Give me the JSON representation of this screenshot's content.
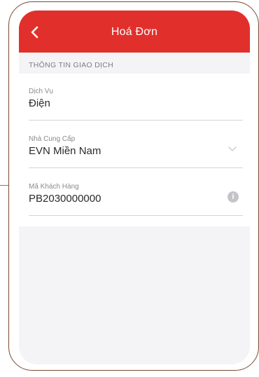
{
  "header": {
    "title": "Hoá Đơn",
    "back_icon": "chevron-left-icon",
    "bg_color": "#e1302c"
  },
  "section": {
    "label": "THÔNG TIN GIAO DỊCH"
  },
  "fields": [
    {
      "label": "Dịch Vụ",
      "value": "Điện"
    },
    {
      "label": "Nhà Cung Cấp",
      "value": "EVN Miền Nam",
      "icon": "chevron-down-icon"
    },
    {
      "label": "Mã Khách Hàng",
      "value": "PB2030000000",
      "icon": "info-icon"
    }
  ]
}
